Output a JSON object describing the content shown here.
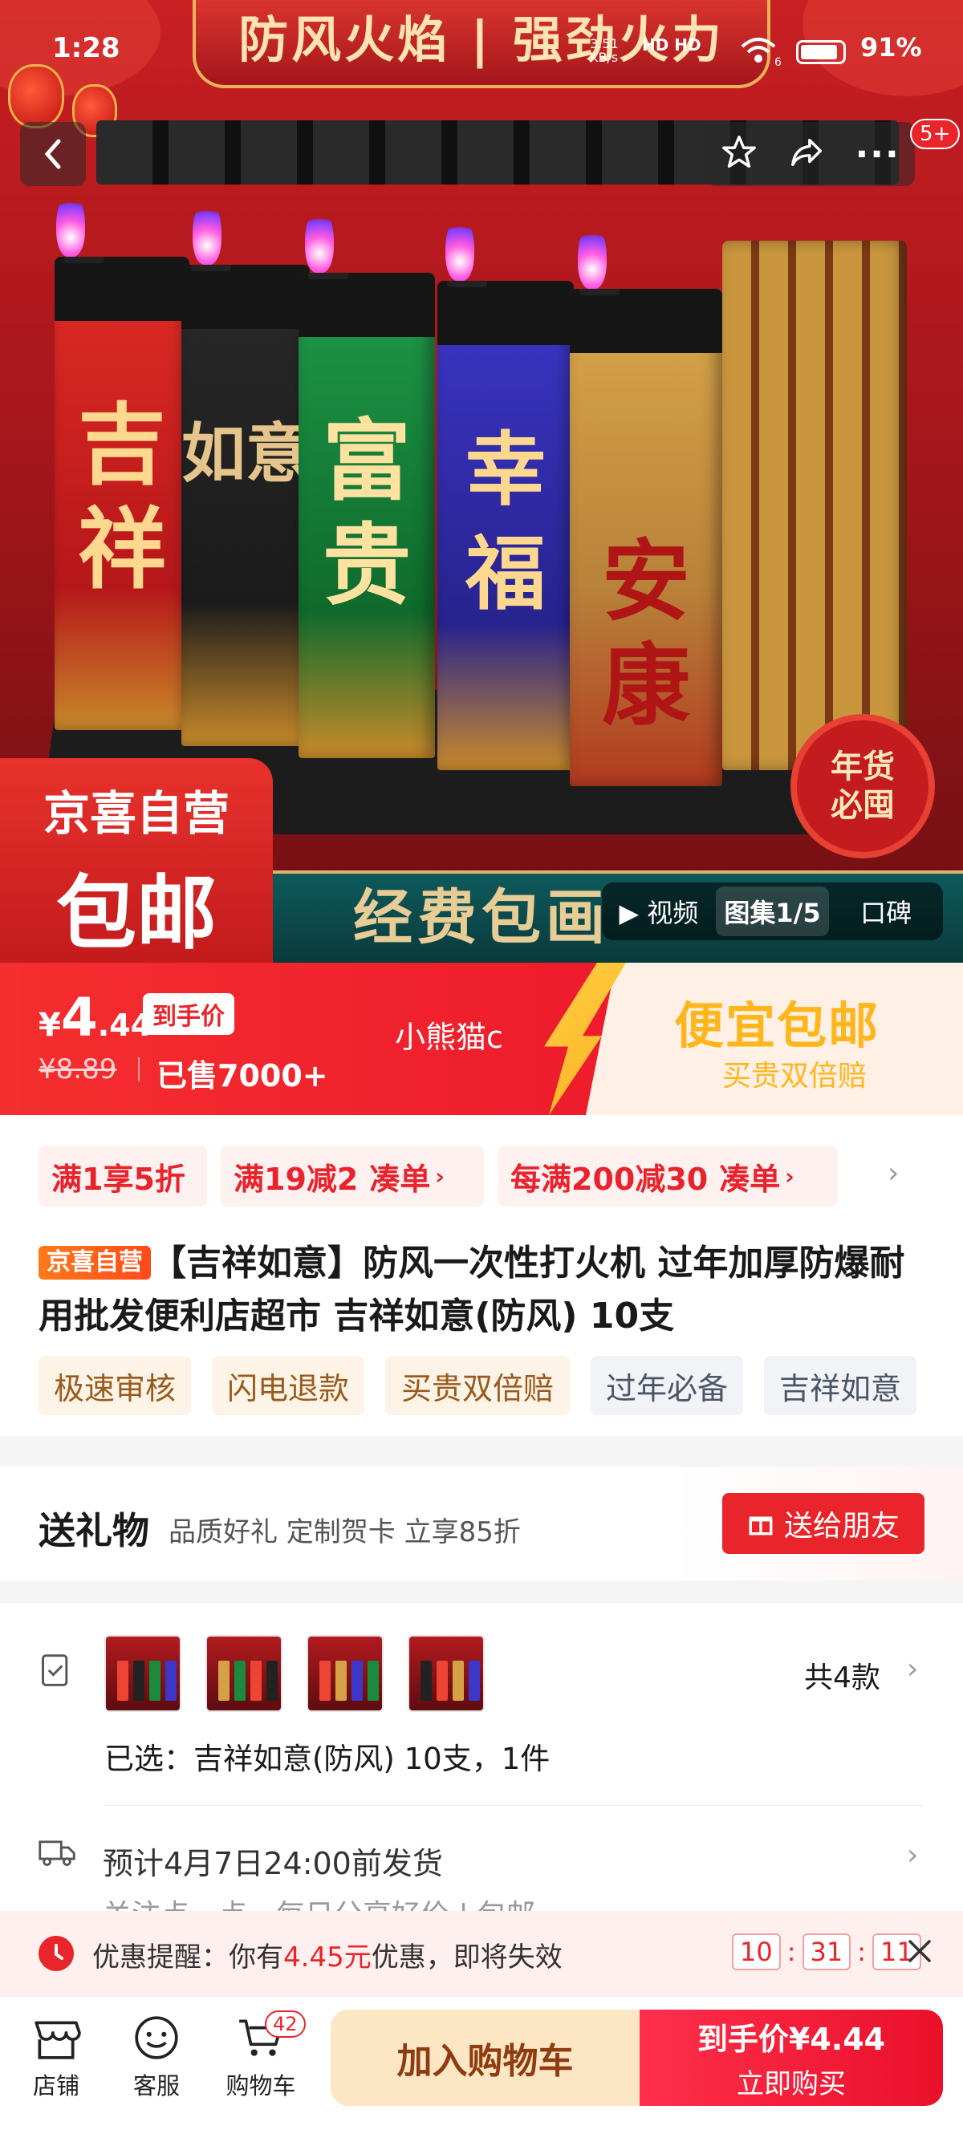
{
  "status_bar": {
    "time": "1:28",
    "net_speed": "3.51 KB/s",
    "net_type": "HD HD",
    "wifi_level": "6",
    "battery": "91%"
  },
  "hero": {
    "banner_text": "防风火焰 | 强劲火力",
    "lighters": [
      "吉祥",
      "如意",
      "富贵",
      "幸福",
      "安康"
    ],
    "self_operated_label": "京喜自营",
    "free_shipping_label": "包邮",
    "seal_line1": "年货",
    "seal_line2": "必囤",
    "bottom_banner": "经费包画",
    "media_video": "视频",
    "media_gallery": "图集1/5",
    "media_reviews": "口碑",
    "notification_badge": "5+"
  },
  "price_bar": {
    "currency": "¥",
    "price_int": "4",
    "price_dec": ".44",
    "price_tag": "到手价",
    "original_price": "¥8.89",
    "sold": "已售7000+",
    "shop_name": "小熊猫c",
    "promo_title": "便宜包邮",
    "promo_sub": "买贵双倍赔"
  },
  "coupons": [
    {
      "text": "满1享5折",
      "action": ""
    },
    {
      "text": "满19减2",
      "action": "凑单"
    },
    {
      "text": "每满200减30",
      "action": "凑单"
    }
  ],
  "product": {
    "badge": "京喜自营",
    "title": "【吉祥如意】防风一次性打火机 过年加厚防爆耐用批发便利店超市 吉祥如意(防风) 10支",
    "tags": [
      "极速审核",
      "闪电退款",
      "买贵双倍赔",
      "过年必备",
      "吉祥如意"
    ]
  },
  "gift": {
    "title": "送礼物",
    "desc": "品质好礼 定制贺卡 立享85折",
    "button": "送给朋友"
  },
  "spec": {
    "count_label": "共4款",
    "selected": "已选：吉祥如意(防风) 10支，1件"
  },
  "shipping": {
    "text": "预计4月7日24:00前发货",
    "sub": "关注点一点，每日分享好价 | 包邮"
  },
  "reminder": {
    "prefix": "优惠提醒：你有",
    "amount": "4.45元",
    "suffix": "优惠，即将失效",
    "h": "10",
    "m": "31",
    "s": "11"
  },
  "bottom": {
    "shop": "店铺",
    "service": "客服",
    "cart": "购物车",
    "cart_badge": "42",
    "add_cart": "加入购物车",
    "buy_price_label": "到手价¥",
    "buy_price": "4.44",
    "buy_now": "立即购买"
  },
  "colors": {
    "accent": "#e9242a",
    "promo_gold": "#ffb51c",
    "buy_gradient_start": "#ff2f4a",
    "cart_button": "#fde6c4"
  }
}
